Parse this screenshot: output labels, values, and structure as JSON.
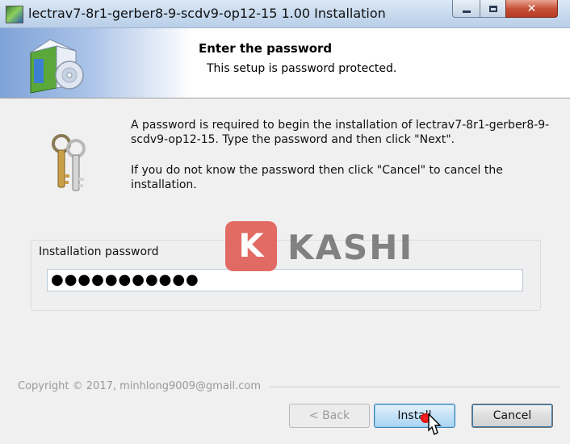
{
  "window": {
    "title": "lectrav7-8r1-gerber8-9-scdv9-op12-15 1.00 Installation",
    "app_icon": "installer-app-icon",
    "controls": {
      "minimize": "minimize-icon",
      "maximize": "maximize-icon",
      "close": "✕"
    }
  },
  "header": {
    "title": "Enter the password",
    "subtitle": "This setup is password protected.",
    "icon": "software-box-icon"
  },
  "message": {
    "icon": "keys-icon",
    "paragraph1": "A password is required to begin the installation of lectrav7-8r1-gerber8-9-scdv9-op12-15. Type the password and then click \"Next\".",
    "paragraph2": "If you do not know the password then click \"Cancel\" to cancel the installation."
  },
  "password": {
    "label": "Installation password",
    "value": "●●●●●●●●●●●"
  },
  "watermark": {
    "badge": "K",
    "text": "KASHI"
  },
  "footer": {
    "copyright": "Copyright © 2017, minhlong9009@gmail.com",
    "buttons": {
      "back": "< Back",
      "install": "Install",
      "cancel": "Cancel"
    }
  },
  "colors": {
    "close_button": "#c8523a",
    "watermark_badge": "#e1625a",
    "focus_border": "#3c7fb1"
  }
}
